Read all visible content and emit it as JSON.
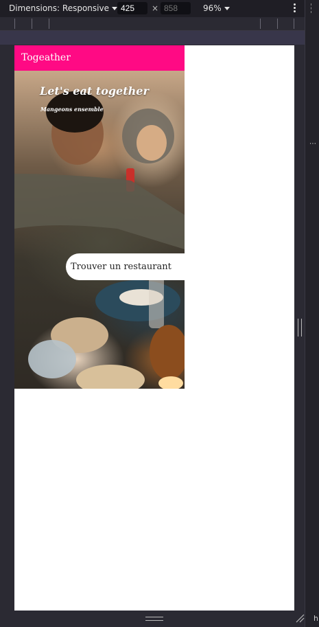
{
  "devtools": {
    "dimensions_label": "Dimensions: Responsive",
    "width_value": "425",
    "height_placeholder": "858",
    "times": "×",
    "zoom_label": "96%",
    "side_text": "h"
  },
  "page": {
    "brand": "Togeather",
    "hero": {
      "title": "Let's eat together",
      "subtitle": "Mangeons ensemble"
    },
    "cta_label": "Trouver un restaurant"
  },
  "colors": {
    "navbar": "#ff0a84",
    "devtools_bg": "#2b2a33"
  }
}
